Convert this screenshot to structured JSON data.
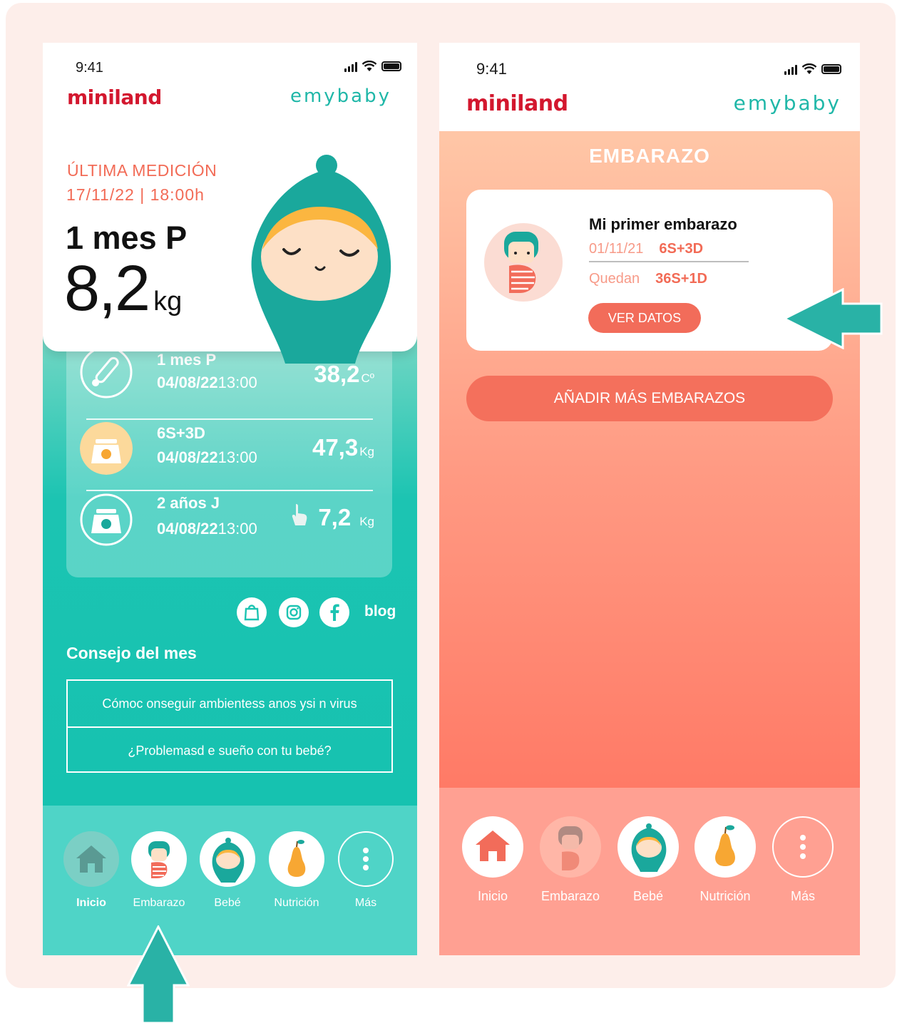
{
  "left": {
    "status_time": "9:41",
    "brand": "miniland",
    "product": "emybaby",
    "last_label": "ÚLTIMA MEDICIÓN",
    "last_date": "17/11/22 | 18:00h",
    "last_name": "1 mes P",
    "last_value": "8,2",
    "last_unit": "kg",
    "records": [
      {
        "name": "1 mes P",
        "date": "04/08/22",
        "time": "13:00",
        "value": "38,2",
        "unit": "Cº",
        "icon": "thermometer-icon"
      },
      {
        "name": "6S+3D",
        "date": "04/08/22",
        "time": "13:00",
        "value": "47,3",
        "unit": "Kg",
        "icon": "scale-icon"
      },
      {
        "name": "2 años J",
        "date": "04/08/22",
        "time": "13:00",
        "value": "7,2",
        "unit": "Kg",
        "icon": "baby-scale-icon"
      }
    ],
    "social": [
      "shop-bag-icon",
      "instagram-icon",
      "facebook-icon"
    ],
    "blog": "blog",
    "consejo_title": "Consejo del mes",
    "tips": [
      "Cómoc onseguir ambientess anos ysi n virus",
      "¿Problemasd e sueño con tu bebé?"
    ],
    "tabs": [
      "Inicio",
      "Embarazo",
      "Bebé",
      "Nutrición",
      "Más"
    ]
  },
  "right": {
    "status_time": "9:41",
    "brand": "miniland",
    "product": "emybaby",
    "page_title": "EMBARAZO",
    "card": {
      "name": "Mi primer embarazo",
      "date": "01/11/21",
      "weeks": "6S+3D",
      "remaining_label": "Quedan",
      "remaining": "36S+1D",
      "button": "VER DATOS"
    },
    "add_button": "AÑADIR MÁS EMBARAZOS",
    "tabs": [
      "Inicio",
      "Embarazo",
      "Bebé",
      "Nutrición",
      "Más"
    ]
  },
  "colors": {
    "teal": "#1cc4b2",
    "coral": "#f26c5a",
    "brand_red": "#d3172e",
    "arrow": "#29b2a6"
  }
}
